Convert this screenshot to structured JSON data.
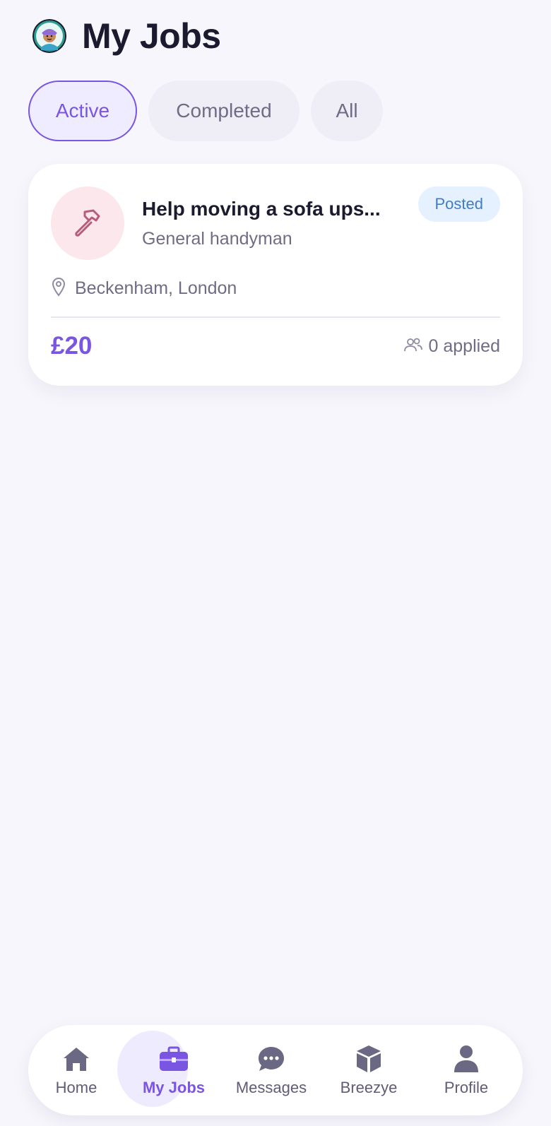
{
  "header": {
    "title": "My Jobs",
    "avatar_icon": "user-avatar-icon"
  },
  "filters": [
    {
      "label": "Active",
      "selected": true
    },
    {
      "label": "Completed",
      "selected": false
    },
    {
      "label": "All",
      "selected": false
    }
  ],
  "jobs": [
    {
      "title": "Help moving a sofa ups...",
      "category": "General handyman",
      "status": "Posted",
      "location": "Beckenham, London",
      "price": "£20",
      "applied": "0 applied",
      "icon": "hammer-icon"
    }
  ],
  "nav": {
    "items": [
      {
        "label": "Home",
        "icon": "home-icon",
        "active": false
      },
      {
        "label": "My Jobs",
        "icon": "briefcase-icon",
        "active": true
      },
      {
        "label": "Messages",
        "icon": "chat-icon",
        "active": false
      },
      {
        "label": "Breezye",
        "icon": "cube-icon",
        "active": false
      },
      {
        "label": "Profile",
        "icon": "person-icon",
        "active": false
      }
    ]
  },
  "colors": {
    "accent": "#7a55e2",
    "background": "#f7f6fc",
    "status_bg": "#e6f1ff",
    "status_text": "#3f7dc7",
    "job_icon_bg": "#fbe7ec"
  }
}
